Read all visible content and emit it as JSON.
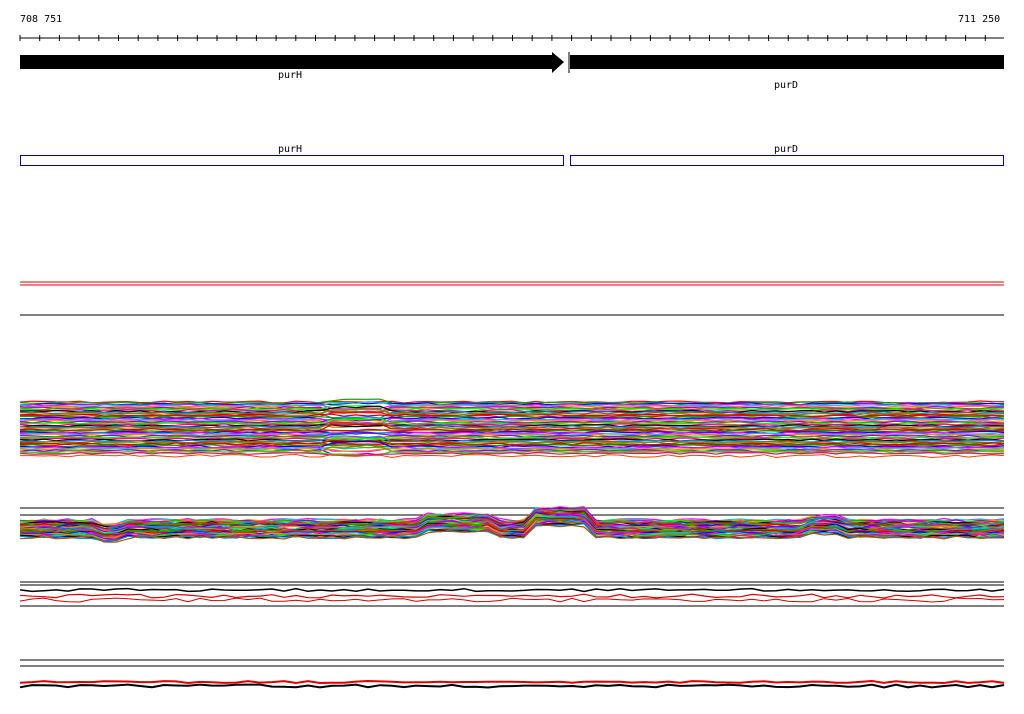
{
  "coords": {
    "start": "708 751",
    "end": "711 250"
  },
  "genes": [
    {
      "name": "purH",
      "strand": "+"
    },
    {
      "name": "purD",
      "strand": "+"
    }
  ],
  "features": [
    {
      "name": "purH"
    },
    {
      "name": "purD"
    }
  ],
  "colors": {
    "gene_arrow": "#000000",
    "feature_box": "#0000aa",
    "track_red": "#dd0000",
    "track_black": "#000000",
    "palette": [
      "#ff0000",
      "#00aa00",
      "#0000ff",
      "#ff00ff",
      "#00cccc",
      "#ff8800",
      "#8800ff",
      "#888800",
      "#00ff00",
      "#ff0088",
      "#000000",
      "#0088ff",
      "#aa5500",
      "#55aa00",
      "#cc0000"
    ]
  }
}
